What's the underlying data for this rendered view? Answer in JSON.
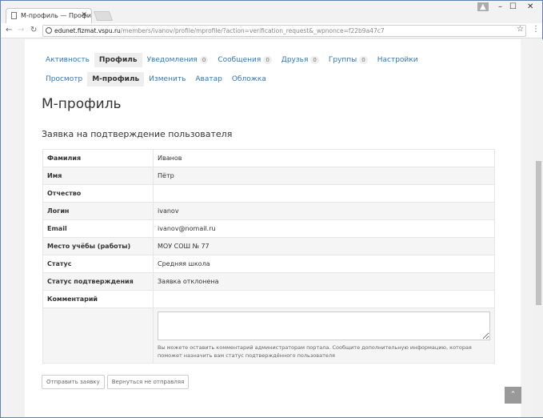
{
  "browser": {
    "tab_title": "М-профиль — Профи",
    "url_host": "edunet.fizmat.vspu.ru",
    "url_path": "/members/ivanov/profile/mprofile/?action=verification_request&_wpnonce=f22b9a47c7"
  },
  "main_nav": [
    {
      "label": "Активность"
    },
    {
      "label": "Профиль",
      "active": true
    },
    {
      "label": "Уведомления",
      "count": "0"
    },
    {
      "label": "Сообщения",
      "count": "0"
    },
    {
      "label": "Друзья",
      "count": "0"
    },
    {
      "label": "Группы",
      "count": "0"
    },
    {
      "label": "Настройки"
    }
  ],
  "sub_nav": [
    {
      "label": "Просмотр"
    },
    {
      "label": "М-профиль",
      "active": true
    },
    {
      "label": "Изменить"
    },
    {
      "label": "Аватар"
    },
    {
      "label": "Обложка"
    }
  ],
  "page_title": "М-профиль",
  "section_title": "Заявка на подтверждение пользователя",
  "rows": [
    {
      "label": "Фамилия",
      "value": "Иванов"
    },
    {
      "label": "Имя",
      "value": "Пётр"
    },
    {
      "label": "Отчество",
      "value": ""
    },
    {
      "label": "Логин",
      "value": "ivanov"
    },
    {
      "label": "Email",
      "value": "ivanov@nomail.ru"
    },
    {
      "label": "Место учёбы (работы)",
      "value": "МОУ СОШ № 77"
    },
    {
      "label": "Статус",
      "value": "Средняя школа"
    },
    {
      "label": "Статус подтверждения",
      "value": "Заявка отклонена"
    },
    {
      "label": "Комментарий",
      "value": ""
    }
  ],
  "comment_hint": "Вы можете оставить комментарий администраторам портала. Сообщите дополнительную информацию, которая поможет назначить вам статус подтверждённого пользователя",
  "buttons": {
    "submit": "Отправить заявку",
    "back": "Вернуться не отправляя"
  }
}
